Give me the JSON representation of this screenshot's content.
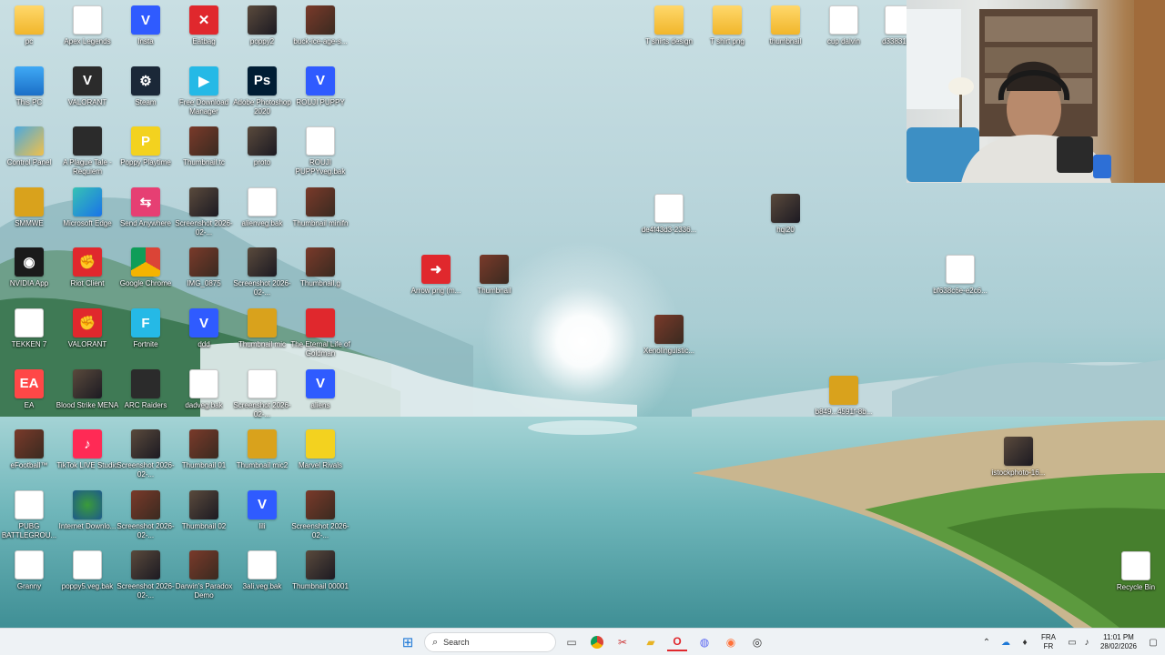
{
  "desktop": {
    "icons": [
      {
        "label": "pc",
        "glyph": "",
        "style": "g-folder",
        "icon": "folder-icon"
      },
      {
        "label": "Apex Legends",
        "glyph": "",
        "style": "g-file",
        "icon": "file-icon"
      },
      {
        "label": "Insta",
        "glyph": "V",
        "style": "g-blue",
        "icon": "vegas-file-icon"
      },
      {
        "label": "Eatbag",
        "glyph": "✕",
        "style": "g-red",
        "icon": "app-icon"
      },
      {
        "label": "poppy2",
        "glyph": "",
        "style": "g-thumb",
        "icon": "image-thumbnail-icon"
      },
      {
        "label": "buck-ice-age-s...",
        "glyph": "",
        "style": "g-thumb2",
        "icon": "image-thumbnail-icon"
      },
      {
        "label": "This PC",
        "glyph": "",
        "style": "g-monitor",
        "icon": "this-pc-icon"
      },
      {
        "label": "VALORANT",
        "glyph": "V",
        "style": "g-dark",
        "icon": "valorant-icon"
      },
      {
        "label": "Steam",
        "glyph": "⚙",
        "style": "g-steam",
        "icon": "steam-icon"
      },
      {
        "label": "Free Download Manager",
        "glyph": "▶",
        "style": "g-cyan",
        "icon": "download-manager-icon"
      },
      {
        "label": "Adobe Photoshop 2020",
        "glyph": "Ps",
        "style": "g-ps",
        "icon": "photoshop-icon"
      },
      {
        "label": "ROUJI PUPPY",
        "glyph": "V",
        "style": "g-blue",
        "icon": "vegas-file-icon"
      },
      {
        "label": "Control Panel",
        "glyph": "",
        "style": "g-cpanel",
        "icon": "control-panel-icon"
      },
      {
        "label": "A Plague Tale - Requiem",
        "glyph": "",
        "style": "g-dark",
        "icon": "game-icon"
      },
      {
        "label": "Poppy Playtime",
        "glyph": "P",
        "style": "g-yellow",
        "icon": "game-icon"
      },
      {
        "label": "Thumbnail.tc",
        "glyph": "",
        "style": "g-thumb2",
        "icon": "image-thumbnail-icon"
      },
      {
        "label": "proto",
        "glyph": "",
        "style": "g-thumb",
        "icon": "image-thumbnail-icon"
      },
      {
        "label": "ROUJI PUPPYveg.bak",
        "glyph": "",
        "style": "g-file",
        "icon": "file-icon"
      },
      {
        "label": "SMMWE",
        "glyph": "",
        "style": "g-gold",
        "icon": "game-icon"
      },
      {
        "label": "Microsoft Edge",
        "glyph": "",
        "style": "g-edge",
        "icon": "edge-icon"
      },
      {
        "label": "Send Anywhere",
        "glyph": "⇆",
        "style": "g-pink",
        "icon": "send-anywhere-icon"
      },
      {
        "label": "Screenshot 2026-02-...",
        "glyph": "",
        "style": "g-thumb",
        "icon": "image-thumbnail-icon"
      },
      {
        "label": "alienveg.bak",
        "glyph": "",
        "style": "g-file",
        "icon": "file-icon"
      },
      {
        "label": "Thumbnail minifn",
        "glyph": "",
        "style": "g-thumb2",
        "icon": "image-thumbnail-icon"
      },
      {
        "label": "NVIDIA App",
        "glyph": "◉",
        "style": "g-nvidia",
        "icon": "nvidia-icon"
      },
      {
        "label": "Riot Client",
        "glyph": "✊",
        "style": "g-red",
        "icon": "riot-client-icon"
      },
      {
        "label": "Google Chrome",
        "glyph": "",
        "style": "g-chrome",
        "icon": "chrome-icon"
      },
      {
        "label": "IMG_0875",
        "glyph": "",
        "style": "g-thumb2",
        "icon": "image-thumbnail-icon"
      },
      {
        "label": "Screenshot 2026-02-...",
        "glyph": "",
        "style": "g-thumb",
        "icon": "image-thumbnail-icon"
      },
      {
        "label": "Thumbnail.g",
        "glyph": "",
        "style": "g-thumb2",
        "icon": "image-thumbnail-icon"
      },
      {
        "label": "TEKKEN 7",
        "glyph": "",
        "style": "g-file",
        "icon": "file-icon"
      },
      {
        "label": "VALORANT",
        "glyph": "✊",
        "style": "g-red",
        "icon": "valorant-icon"
      },
      {
        "label": "Fortnite",
        "glyph": "F",
        "style": "g-cyan",
        "icon": "fortnite-icon"
      },
      {
        "label": "ddd",
        "glyph": "V",
        "style": "g-blue",
        "icon": "vegas-file-icon"
      },
      {
        "label": "Thumbnail mic",
        "glyph": "",
        "style": "g-gold",
        "icon": "image-thumbnail-icon"
      },
      {
        "label": "The Eternal Life of Goldman",
        "glyph": "",
        "style": "g-red",
        "icon": "game-icon"
      },
      {
        "label": "EA",
        "glyph": "EA",
        "style": "g-ea",
        "icon": "ea-icon"
      },
      {
        "label": "Blood Strike MENA",
        "glyph": "",
        "style": "g-thumb",
        "icon": "game-icon"
      },
      {
        "label": "ARC Raiders",
        "glyph": "",
        "style": "g-dark",
        "icon": "game-icon"
      },
      {
        "label": "dadveg.bak",
        "glyph": "",
        "style": "g-file",
        "icon": "file-icon"
      },
      {
        "label": "Screenshot 2026-02-...",
        "glyph": "",
        "style": "g-file",
        "icon": "image-thumbnail-icon"
      },
      {
        "label": "aliens",
        "glyph": "V",
        "style": "g-blue",
        "icon": "vegas-file-icon"
      },
      {
        "label": "eFootball™",
        "glyph": "",
        "style": "g-thumb2",
        "icon": "game-icon"
      },
      {
        "label": "TikTok LIVE Studio",
        "glyph": "♪",
        "style": "g-tiktok",
        "icon": "tiktok-icon"
      },
      {
        "label": "Screenshot 2026-02-...",
        "glyph": "",
        "style": "g-thumb",
        "icon": "image-thumbnail-icon"
      },
      {
        "label": "Thumbnail 01",
        "glyph": "",
        "style": "g-thumb2",
        "icon": "image-thumbnail-icon"
      },
      {
        "label": "Thumbnail mic2",
        "glyph": "",
        "style": "g-gold",
        "icon": "image-thumbnail-icon"
      },
      {
        "label": "Marvel Rivals",
        "glyph": "",
        "style": "g-yellow",
        "icon": "game-icon"
      },
      {
        "label": "PUBG BATTLEGROU...",
        "glyph": "",
        "style": "g-file",
        "icon": "file-icon"
      },
      {
        "label": "Internet Downlo...",
        "glyph": "",
        "style": "g-idm",
        "icon": "idm-icon"
      },
      {
        "label": "Screenshot 2026-02-...",
        "glyph": "",
        "style": "g-thumb2",
        "icon": "image-thumbnail-icon"
      },
      {
        "label": "Thumbnail 02",
        "glyph": "",
        "style": "g-thumb",
        "icon": "image-thumbnail-icon"
      },
      {
        "label": "lili",
        "glyph": "V",
        "style": "g-blue",
        "icon": "vegas-file-icon"
      },
      {
        "label": "Screenshot 2026-02-...",
        "glyph": "",
        "style": "g-thumb2",
        "icon": "image-thumbnail-icon"
      },
      {
        "label": "Granny",
        "glyph": "",
        "style": "g-file",
        "icon": "file-icon"
      },
      {
        "label": "poppy5.veg.bak",
        "glyph": "",
        "style": "g-file",
        "icon": "file-icon"
      },
      {
        "label": "Screenshot 2026-02-...",
        "glyph": "",
        "style": "g-thumb",
        "icon": "image-thumbnail-icon"
      },
      {
        "label": "Darwin's Paradox Demo",
        "glyph": "",
        "style": "g-thumb2",
        "icon": "game-icon"
      },
      {
        "label": "3ali.veg.bak",
        "glyph": "",
        "style": "g-file",
        "icon": "file-icon"
      },
      {
        "label": "Thumbnail 00001",
        "glyph": "",
        "style": "g-thumb",
        "icon": "image-thumbnail-icon"
      }
    ],
    "floating_icons": [
      {
        "label": "Arrow png (m...",
        "glyph": "➜",
        "style": "g-red",
        "icon": "arrow-image-icon"
      },
      {
        "label": "Thumbnail",
        "glyph": "",
        "style": "g-thumb2",
        "icon": "image-thumbnail-icon"
      },
      {
        "label": "de4f43d3-2336...",
        "glyph": "",
        "style": "g-file",
        "icon": "image-thumbnail-icon"
      },
      {
        "label": "hqi20",
        "glyph": "",
        "style": "g-thumb",
        "icon": "image-thumbnail-icon"
      },
      {
        "label": "Xenolinguistic...",
        "glyph": "",
        "style": "g-thumb2",
        "icon": "image-thumbnail-icon"
      },
      {
        "label": "b849...4591f-8b...",
        "glyph": "",
        "style": "g-gold",
        "icon": "image-thumbnail-icon"
      },
      {
        "label": "bf638c6e-e2c6...",
        "glyph": "",
        "style": "g-file",
        "icon": "image-thumbnail-icon"
      },
      {
        "label": "istockphoto-16...",
        "glyph": "",
        "style": "g-thumb",
        "icon": "image-thumbnail-icon"
      },
      {
        "label": "T shirts design",
        "glyph": "",
        "style": "g-folder",
        "icon": "folder-icon"
      },
      {
        "label": "T shirt png",
        "glyph": "",
        "style": "g-folder",
        "icon": "folder-icon"
      },
      {
        "label": "thumbnail",
        "glyph": "",
        "style": "g-folder",
        "icon": "folder-icon"
      },
      {
        "label": "cup dalvin",
        "glyph": "",
        "style": "g-file",
        "icon": "file-icon"
      },
      {
        "label": "d338312...",
        "glyph": "",
        "style": "g-file",
        "icon": "file-icon"
      },
      {
        "label": "Recycle Bin",
        "glyph": "♻",
        "style": "g-file",
        "icon": "recycle-bin-icon"
      }
    ]
  },
  "taskbar": {
    "search_placeholder": "Search",
    "apps": [
      {
        "icon": "start-icon",
        "glyph": "⊞"
      },
      {
        "icon": "task-view-icon",
        "glyph": "▭"
      },
      {
        "icon": "chrome-icon",
        "glyph": "●"
      },
      {
        "icon": "snipping-tool-icon",
        "glyph": "✂"
      },
      {
        "icon": "file-explorer-icon",
        "glyph": "▰"
      },
      {
        "icon": "opera-icon",
        "glyph": "O"
      },
      {
        "icon": "discord-icon",
        "glyph": "◍"
      },
      {
        "icon": "firefox-icon",
        "glyph": "◉"
      },
      {
        "icon": "recording-app-icon",
        "glyph": "◎"
      }
    ],
    "tray": {
      "language_top": "FRA",
      "language_bottom": "FR",
      "time": "11:01 PM",
      "date": "28/02/2026"
    }
  }
}
